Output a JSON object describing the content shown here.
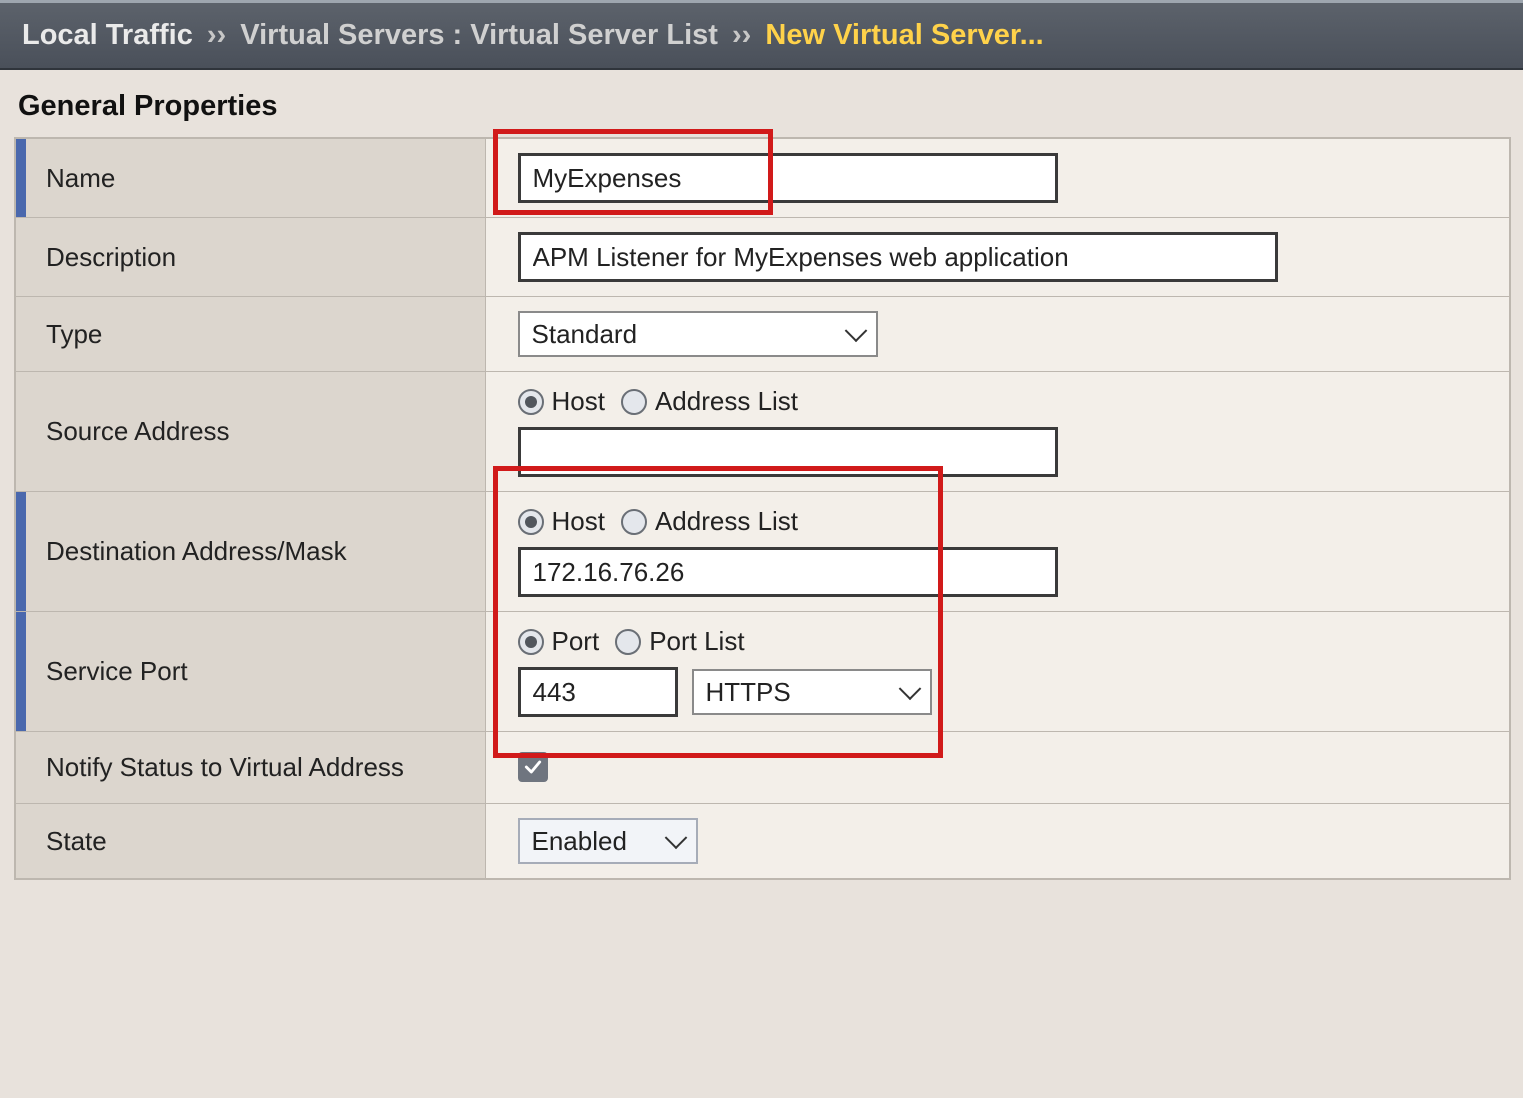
{
  "breadcrumb": {
    "item1": "Local Traffic",
    "sep": "››",
    "item2": "Virtual Servers : Virtual Server List",
    "item3": "New Virtual Server..."
  },
  "section_title": "General Properties",
  "labels": {
    "name": "Name",
    "description": "Description",
    "type": "Type",
    "source_address": "Source Address",
    "destination": "Destination Address/Mask",
    "service_port": "Service Port",
    "notify": "Notify Status to Virtual Address",
    "state": "State"
  },
  "radio": {
    "host": "Host",
    "address_list": "Address List",
    "port": "Port",
    "port_list": "Port List"
  },
  "values": {
    "name": "MyExpenses",
    "description": "APM Listener for MyExpenses web application",
    "type": "Standard",
    "source_address": "",
    "destination": "172.16.76.26",
    "port": "443",
    "protocol": "HTTPS",
    "state": "Enabled"
  }
}
